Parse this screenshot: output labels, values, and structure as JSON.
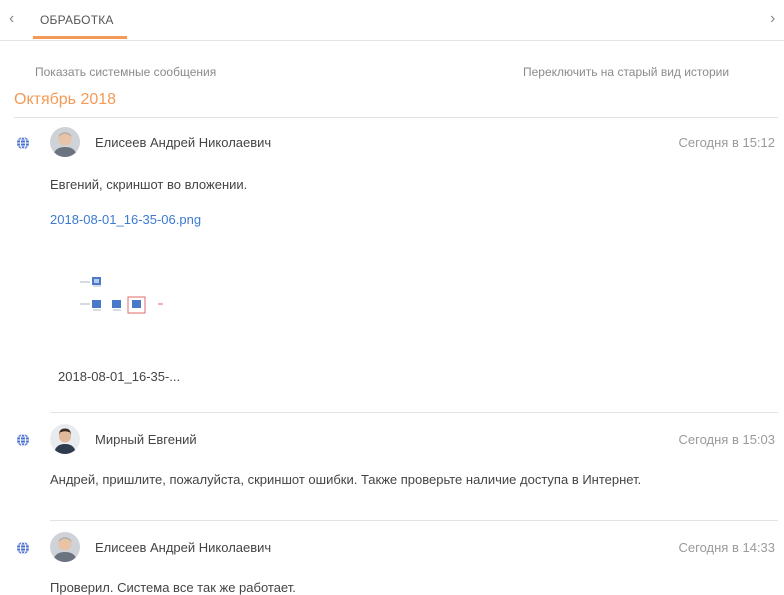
{
  "tab": {
    "label": "ОБРАБОТКА"
  },
  "nav": {
    "prev_icon": "chevron-left-icon",
    "next_icon": "chevron-right-icon"
  },
  "toolbar": {
    "show_system": "Показать системные сообщения",
    "switch_view": "Переключить на старый вид истории"
  },
  "month_header": "Октябрь 2018",
  "colors": {
    "accent": "#f39a57",
    "link": "#3b7bd3",
    "channel_icon": "#4a6fcf"
  },
  "feed": [
    {
      "author": "Елисеев Андрей Николаевич",
      "time": "Сегодня в 15:12",
      "text": "Евгений, скриншот во вложении.",
      "attachment": {
        "link": "2018-08-01_16-35-06.png",
        "caption": "2018-08-01_16-35-..."
      }
    },
    {
      "author": "Мирный Евгений",
      "time": "Сегодня в 15:03",
      "text": "Андрей, пришлите, пожалуйста, скриншот ошибки. Также проверьте наличие доступа в Интернет."
    },
    {
      "author": "Елисеев Андрей Николаевич",
      "time": "Сегодня в 14:33",
      "text": "Проверил. Система все так же работает."
    }
  ]
}
